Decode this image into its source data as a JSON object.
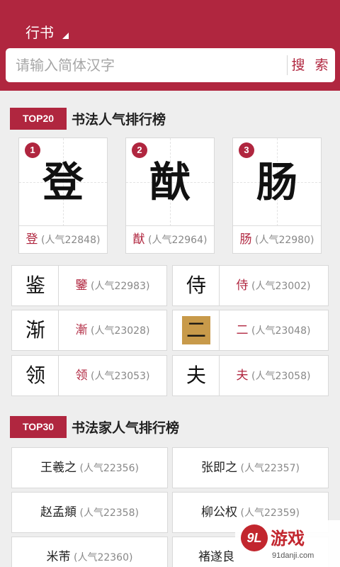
{
  "header": {
    "style_label": "行书",
    "search_placeholder": "请输入简体汉字",
    "search_button": "搜 索"
  },
  "section_chars": {
    "tag": "TOP20",
    "title": "书法人气排行榜"
  },
  "top_chars": [
    {
      "rank": "1",
      "char": "登",
      "pop": "(人气22848)"
    },
    {
      "rank": "2",
      "char": "猷",
      "pop": "(人气22964)"
    },
    {
      "rank": "3",
      "char": "肠",
      "pop": "(人气22980)"
    }
  ],
  "char_rows": [
    {
      "glyph": "鉴",
      "char": "鑒",
      "pop": "(人气22983)"
    },
    {
      "glyph": "侍",
      "char": "侍",
      "pop": "(人气23002)"
    },
    {
      "glyph": "渐",
      "char": "漸",
      "pop": "(人气23028)"
    },
    {
      "glyph": "二",
      "char": "二",
      "pop": "(人气23048)"
    },
    {
      "glyph": "领",
      "char": "领",
      "pop": "(人气23053)"
    },
    {
      "glyph": "夫",
      "char": "夫",
      "pop": "(人气23058)"
    }
  ],
  "section_authors": {
    "tag": "TOP30",
    "title": "书法家人气排行榜"
  },
  "authors": [
    {
      "name": "王羲之",
      "pop": "(人气22356)"
    },
    {
      "name": "张即之",
      "pop": "(人气22357)"
    },
    {
      "name": "赵孟頫",
      "pop": "(人气22358)"
    },
    {
      "name": "柳公权",
      "pop": "(人气22359)"
    },
    {
      "name": "米芾",
      "pop": "(人气22360)"
    },
    {
      "name": "褚遂良",
      "pop": ""
    }
  ],
  "watermark": {
    "logo": "9L",
    "text": "游戏",
    "url": "91danji.com"
  },
  "colors": {
    "brand": "#b0263f",
    "background": "#eeeeee",
    "watermark": "#c2262e"
  }
}
